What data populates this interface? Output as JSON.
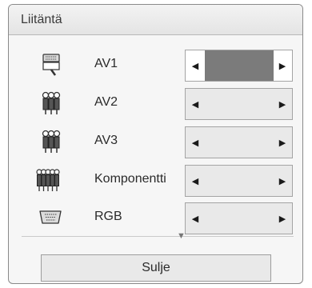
{
  "dialog": {
    "title": "Liitäntä"
  },
  "inputs": [
    {
      "label": "AV1",
      "icon": "scart-connector-icon",
      "value": "",
      "selected": true
    },
    {
      "label": "AV2",
      "icon": "rca-av-connector-icon",
      "value": ""
    },
    {
      "label": "AV3",
      "icon": "rca-av-connector-icon",
      "value": ""
    },
    {
      "label": "Komponentti",
      "icon": "component-connector-icon",
      "value": ""
    },
    {
      "label": "RGB",
      "icon": "vga-connector-icon",
      "value": ""
    }
  ],
  "selector": {
    "left_arrow": "◀",
    "right_arrow": "▶"
  },
  "scroll": {
    "down_arrow": "▼"
  },
  "footer": {
    "close_label": "Sulje"
  },
  "colors": {
    "selected_value_bg": "#7b7b7b",
    "selector_bg": "#e9e9e9"
  }
}
